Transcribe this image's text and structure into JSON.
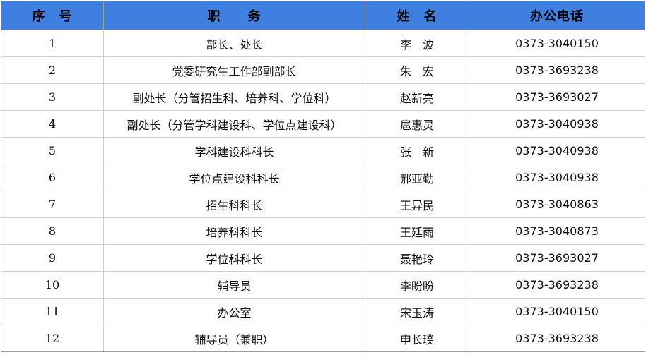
{
  "table": {
    "headers": [
      "序　号",
      "职　　务",
      "姓　名",
      "办公电话"
    ],
    "rows": [
      [
        "1",
        "部长、处长",
        "李　波",
        "0373-3040150"
      ],
      [
        "2",
        "党委研究生工作部副部长",
        "朱　宏",
        "0373-3693238"
      ],
      [
        "3",
        "副处长（分管招生科、培养科、学位科）",
        "赵新亮",
        "0373-3693027"
      ],
      [
        "4",
        "副处长（分管学科建设科、学位点建设科）",
        "扈惠灵",
        "0373-3040938"
      ],
      [
        "5",
        "学科建设科科长",
        "张　新",
        "0373-3040938"
      ],
      [
        "6",
        "学位点建设科科长",
        "郝亚勤",
        "0373-3040938"
      ],
      [
        "7",
        "招生科科长",
        "王异民",
        "0373-3040863"
      ],
      [
        "8",
        "培养科科长",
        "王廷雨",
        "0373-3040873"
      ],
      [
        "9",
        "学位科科长",
        "聂艳玲",
        "0373-3693027"
      ],
      [
        "10",
        "辅导员",
        "李盼盼",
        "0373-3693238"
      ],
      [
        "11",
        "办公室",
        "宋玉涛",
        "0373-3040150"
      ],
      [
        "12",
        "辅导员（兼职）",
        "申长璞",
        "0373-3693238"
      ]
    ]
  },
  "colors": {
    "header_bg": "#3f7fe0",
    "grid": "#d0d0d0"
  }
}
